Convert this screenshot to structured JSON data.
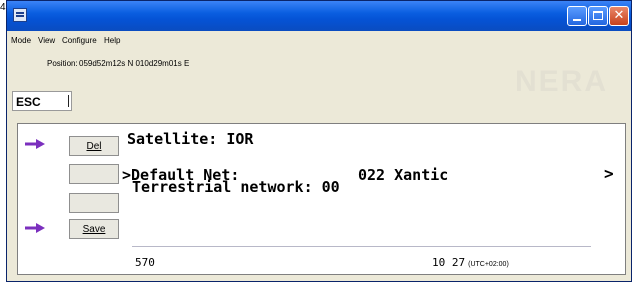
{
  "edge_mark": "4",
  "window": {
    "menu": [
      "Mode",
      "View",
      "Configure",
      "Help"
    ]
  },
  "position": {
    "label": "Position:",
    "value": "059d52m12s N 010d29m01s E"
  },
  "watermark": "NERA",
  "esc_label": "ESC",
  "softkeys": {
    "del": "Del",
    "save": "Save"
  },
  "display": {
    "satellite": "Satellite: IOR",
    "default_net_label": ">Default Net:",
    "default_net_value": "022 Xantic",
    "terrestrial": "Terrestrial network: 00",
    "chevron": ">"
  },
  "status": {
    "left": "570",
    "time": "10 27",
    "timezone": "(UTC+02:00)"
  },
  "colors": {
    "titlebar": "#0553d6",
    "arrow": "#7b2fbe",
    "window_bg": "#ece9d8"
  },
  "icons": [
    "app-icon",
    "minimize-icon",
    "maximize-icon",
    "close-icon",
    "arrow-right-icon"
  ]
}
